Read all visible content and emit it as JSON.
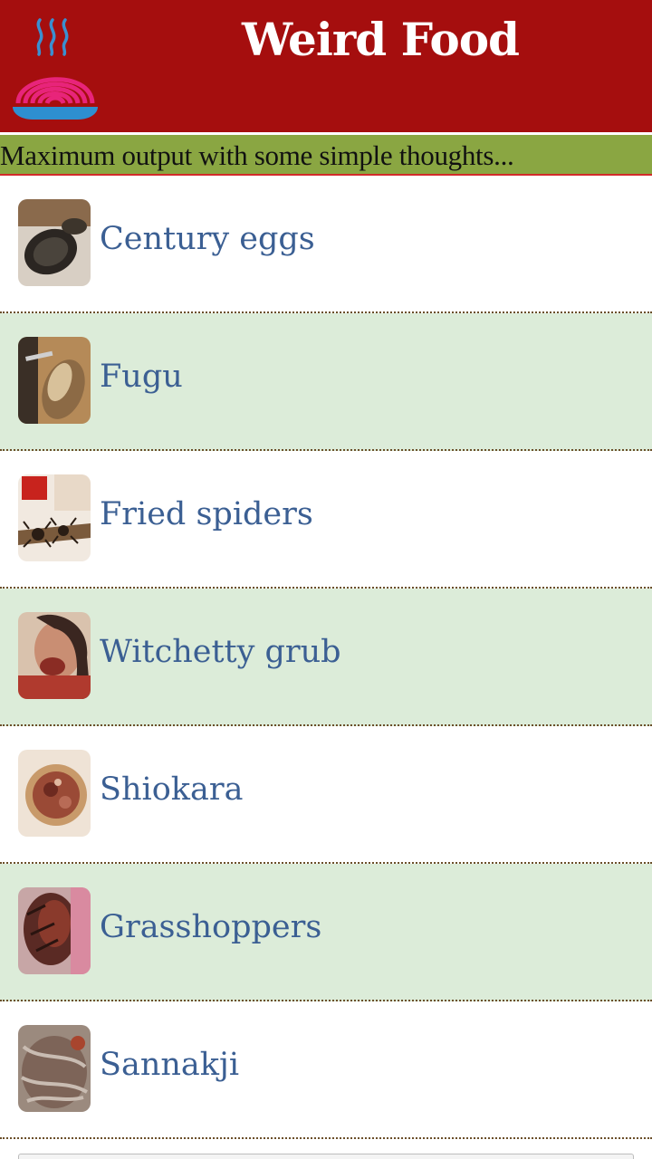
{
  "header": {
    "title": "Weird Food",
    "logo_icon": "steaming-noodle-bowl-icon",
    "background_color": "#a50e0e"
  },
  "tagline": {
    "text": "Maximum output with some simple thoughts...",
    "background_color": "#8aa642"
  },
  "list": {
    "label_color": "#3b5f93",
    "alt_row_color": "#dcecd9",
    "items": [
      {
        "label": "Century eggs",
        "thumbnail": "century-eggs-photo"
      },
      {
        "label": "Fugu",
        "thumbnail": "fugu-photo"
      },
      {
        "label": "Fried spiders",
        "thumbnail": "fried-spiders-photo"
      },
      {
        "label": "Witchetty grub",
        "thumbnail": "witchetty-grub-photo"
      },
      {
        "label": "Shiokara",
        "thumbnail": "shiokara-photo"
      },
      {
        "label": "Grasshoppers",
        "thumbnail": "grasshoppers-photo"
      },
      {
        "label": "Sannakji",
        "thumbnail": "sannakji-photo"
      }
    ]
  }
}
